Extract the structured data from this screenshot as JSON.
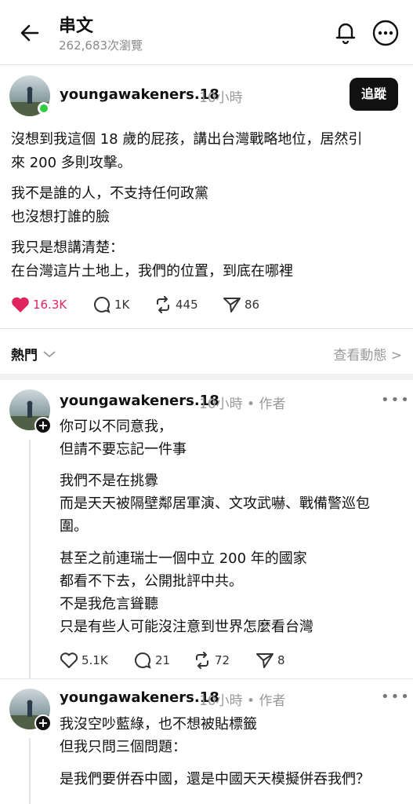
{
  "header": {
    "title": "串文",
    "views": "262,683次瀏覽"
  },
  "post": {
    "username": "youngawakeners.18",
    "time": "10小時",
    "follow_label": "追蹤",
    "paragraphs": [
      [
        "沒想到我這個 18 歲的屁孩，講出台灣戰略地位，居然引",
        "來 200 多則攻擊。"
      ],
      [
        "我不是誰的人，不支持任何政黨",
        "也沒想打誰的臉"
      ],
      [
        "我只是想講清楚：",
        "在台灣這片土地上，我們的位置，到底在哪裡"
      ]
    ],
    "likes": "16.3K",
    "replies": "1K",
    "reposts": "445",
    "shares": "86"
  },
  "sort": {
    "label": "熱門",
    "activity_label": "查看動態 >"
  },
  "comments": [
    {
      "username": "youngawakeners.18",
      "meta": "10小時 • 作者",
      "paragraphs": [
        [
          "你可以不同意我，",
          "但請不要忘記一件事"
        ],
        [
          "我們不是在挑釁",
          "而是天天被隔壁鄰居軍演、文攻武嚇、戰備警巡包",
          "圍。"
        ],
        [
          "甚至之前連瑞士一個中立 200 年的國家",
          "都看不下去，公開批評中共。",
          "不是我危言聳聽",
          "只是有些人可能沒注意到世界怎麼看台灣"
        ]
      ],
      "likes": "5.1K",
      "replies": "21",
      "reposts": "72",
      "shares": "8"
    },
    {
      "username": "youngawakeners.18",
      "meta": "10小時 • 作者",
      "paragraphs": [
        [
          "我沒空吵藍綠，也不想被貼標籤",
          "但我只問三個問題："
        ],
        [
          "是我們要併吞中國，還是中國天天模擬併吞我們？"
        ]
      ]
    }
  ]
}
